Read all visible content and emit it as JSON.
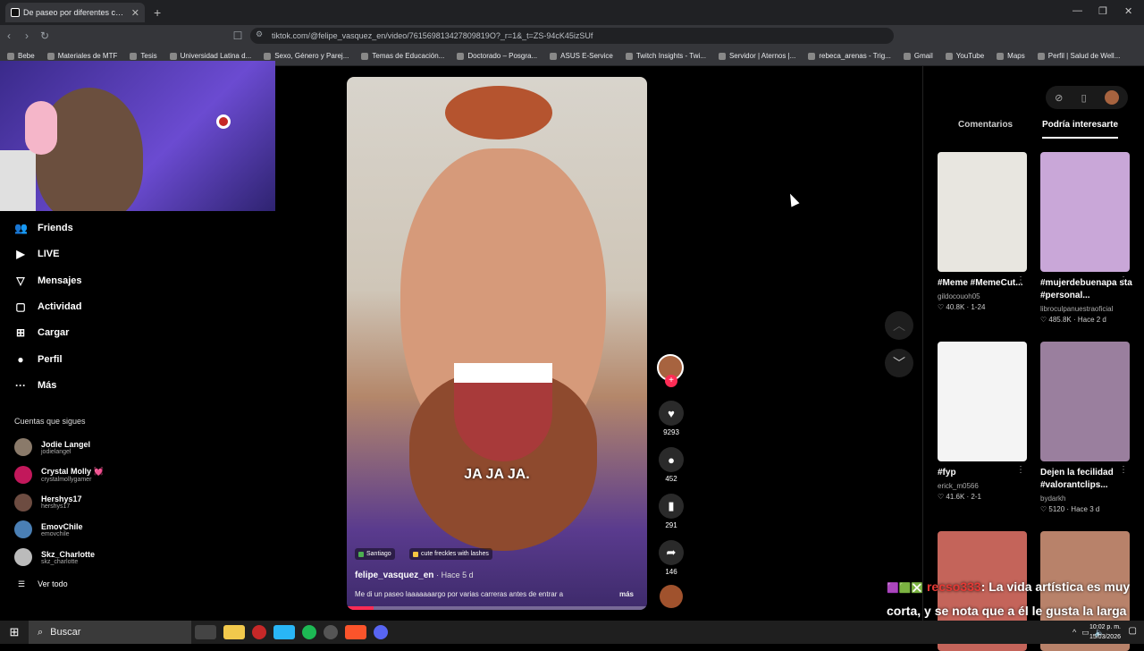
{
  "browser": {
    "tab_title": "De paseo por diferentes carre",
    "url": "tiktok.com/@felipe_vasquez_en/video/761569813427809819O?_r=1&_t=ZS-94cK45izSUf",
    "bookmarks": [
      "Bebe",
      "Materiales de MTF",
      "Tesis",
      "Universidad Latina d...",
      "Sexo, Género y Parej...",
      "Temas de Educación...",
      "Doctorado – Posgra...",
      "ASUS E-Service",
      "Twitch Insights - Twi...",
      "Servidor | Aternos |...",
      "rebeca_arenas - Trig...",
      "Gmail",
      "YouTube",
      "Maps",
      "Perfil | Salud de Well..."
    ]
  },
  "sidebar": {
    "nav": [
      {
        "label": "Friends",
        "icon": "friends-icon",
        "glyph": "👥"
      },
      {
        "label": "LIVE",
        "icon": "live-icon",
        "glyph": "▶"
      },
      {
        "label": "Mensajes",
        "icon": "messages-icon",
        "glyph": "▽"
      },
      {
        "label": "Actividad",
        "icon": "activity-icon",
        "glyph": "▢"
      },
      {
        "label": "Cargar",
        "icon": "upload-icon",
        "glyph": "⊞"
      },
      {
        "label": "Perfil",
        "icon": "profile-icon",
        "glyph": "●"
      },
      {
        "label": "Más",
        "icon": "more-icon",
        "glyph": "···"
      }
    ],
    "following_title": "Cuentas que sigues",
    "accounts": [
      {
        "name": "Jodie Langel",
        "handle": "jodielangel",
        "color": "#8a7a6a"
      },
      {
        "name": "Crystal Molly 💓",
        "handle": "crystalmollygamer",
        "color": "#c2185b"
      },
      {
        "name": "Hershys17",
        "handle": "hershys17",
        "color": "#6d4c41"
      },
      {
        "name": "EmovChile",
        "handle": "emovchile",
        "color": "#4a7fb5"
      },
      {
        "name": "Skz_Charlotte",
        "handle": "skz_charlotte",
        "color": "#bbbbbb"
      }
    ],
    "see_all": "Ver todo"
  },
  "video": {
    "caption": "JA JA JA.",
    "tags": [
      {
        "label": "Santiago",
        "color": "#4caf50"
      },
      {
        "label": "cute freckles with lashes",
        "color": "#f5c542"
      }
    ],
    "author": "felipe_vasquez_en",
    "time": "· Hace 5 d",
    "description": "Me di un paseo laaaaaaargo por varias carreras antes de entrar a",
    "more": "más"
  },
  "actions": {
    "likes": "9293",
    "comments": "452",
    "saves": "291",
    "shares": "146"
  },
  "panel": {
    "tab_comments": "Comentarios",
    "tab_interest": "Podría interesarte",
    "cards": [
      {
        "title": "#Meme #MemeCut...",
        "user": "gildocouoh05",
        "meta": "♡ 40.8K · 1-24",
        "color": "#e8e6e0"
      },
      {
        "title": "#mujerdebuenapa sta #personal...",
        "user": "librocul​panuestraoficial",
        "meta": "♡ 485.8K · Hace 2 d",
        "color": "#c9a7d8"
      },
      {
        "title": "#fyp",
        "user": "erick_m0566",
        "meta": "♡ 41.6K · 2-1",
        "color": "#f4f4f4"
      },
      {
        "title": "Dejen la fecilidad #valorantclips...",
        "user": "bydarkh",
        "meta": "♡ 5120 · Hace 3 d",
        "color": "#9a7f9e"
      },
      {
        "title": "",
        "user": "",
        "meta": "",
        "color": "#c4645a"
      },
      {
        "title": "",
        "user": "",
        "meta": "",
        "color": "#b8826a"
      }
    ]
  },
  "chat": {
    "user": "recso333",
    "message": ": La vida artística es muy corta, y se nota que a él le gusta la larga"
  },
  "taskbar": {
    "search": "Buscar",
    "time": "10:02 p. m.",
    "date": "15/03/2026"
  }
}
